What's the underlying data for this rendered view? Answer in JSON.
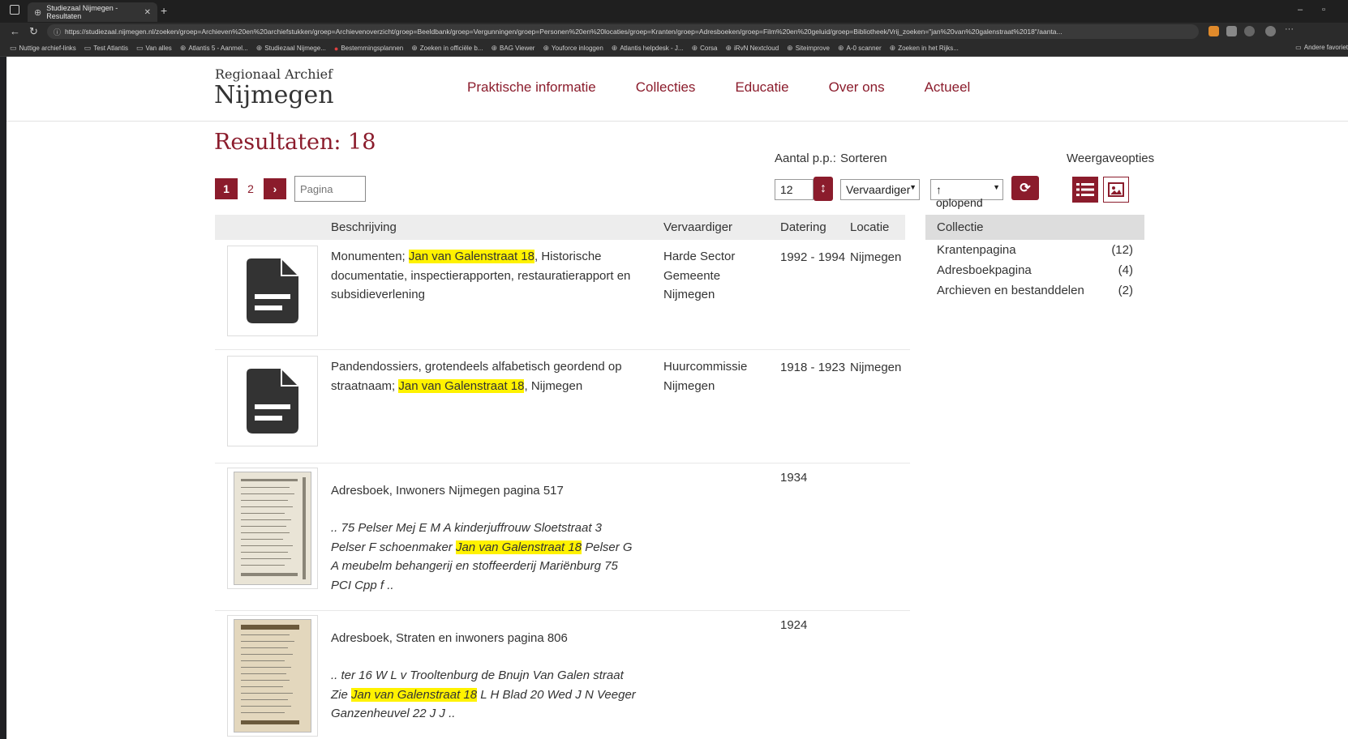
{
  "browser": {
    "tab_title": "Studiezaal Nijmegen - Resultaten",
    "url": "https://studiezaal.nijmegen.nl/zoeken/groep=Archieven%20en%20archiefstukken/groep=Archievenoverzicht/groep=Beeldbank/groep=Vergunningen/groep=Personen%20en%20locaties/groep=Kranten/groep=Adresboeken/groep=Film%20en%20geluid/groep=Bibliotheek/Vrij_zoeken=\"jan%20van%20galenstraat%2018\"/aanta...",
    "bookmarks": [
      "Nuttige archief-links",
      "Test Atlantis",
      "Van alles",
      "Atlantis 5 - Aanmel...",
      "Studiezaal Nijmege...",
      "Bestemmingsplannen",
      "Zoeken in officiële b...",
      "BAG Viewer",
      "Youforce inloggen",
      "Atlantis helpdesk - J...",
      "Corsa",
      "iRvN Nextcloud",
      "Siteimprove",
      "A-0 scanner",
      "Zoeken in het Rijks..."
    ],
    "other_bookmarks": "Andere favoriet"
  },
  "header": {
    "logo_top": "Regionaal Archief",
    "logo_main": "Nijmegen",
    "nav": [
      "Praktische informatie",
      "Collecties",
      "Educatie",
      "Over ons",
      "Actueel"
    ]
  },
  "results": {
    "title": "Resultaten: 18",
    "pages": [
      "1",
      "2"
    ],
    "next": "›",
    "page_placeholder": "Pagina"
  },
  "controls": {
    "per_page_label": "Aantal p.p.:",
    "per_page_value": "12",
    "sort_label": "Sorteren",
    "sort_value": "Vervaardiger",
    "order_value": "↑ oplopend",
    "view_label": "Weergaveopties"
  },
  "table": {
    "headers": {
      "description": "Beschrijving",
      "maker": "Vervaardiger",
      "date": "Datering",
      "location": "Locatie"
    },
    "rows": [
      {
        "desc_pre": "Monumenten; ",
        "desc_hl": "Jan van Galenstraat 18",
        "desc_post": ", Historische documentatie, inspectierapporten, restauratierapport en subsidieverlening",
        "maker": "Harde Sector Gemeente Nijmegen",
        "date": "1992 - 1994",
        "location": "Nijmegen"
      },
      {
        "desc_pre": "Pandendossiers, grotendeels alfabetisch geordend op straatnaam; ",
        "desc_hl": "Jan van Galenstraat 18",
        "desc_post": ", Nijmegen",
        "maker": "Huurcommissie Nijmegen",
        "date": "1918 - 1923",
        "location": "Nijmegen"
      },
      {
        "title": "Adresboek, Inwoners Nijmegen pagina 517",
        "snip_pre": ".. 75 Pelser Mej E M A kinderjuffrouw Sloetstraat 3 Pelser F schoenmaker ",
        "snip_hl": "Jan van Galenstraat 18",
        "snip_post": " Pelser G A meubelm behangerij en stoffeerderij Mariënburg 75 PCI Cpp f ..",
        "date": "1934"
      },
      {
        "title": "Adresboek, Straten en inwoners pagina 806",
        "snip_pre": ".. ter 16 W L v Trooltenburg de Bnujn Van Galen straat Zie ",
        "snip_hl": "Jan van Galenstraat 18",
        "snip_post": " L H Blad 20 Wed J N Veeger Ganzenheuvel 22 J J ..",
        "date": "1924"
      }
    ]
  },
  "facets": {
    "title": "Collectie",
    "items": [
      {
        "label": "Krantenpagina",
        "count": "(12)"
      },
      {
        "label": "Adresboekpagina",
        "count": "(4)"
      },
      {
        "label": "Archieven en bestanddelen",
        "count": "(2)"
      }
    ]
  },
  "colors": {
    "brand": "#8b1c2c",
    "highlight": "#fff200"
  }
}
